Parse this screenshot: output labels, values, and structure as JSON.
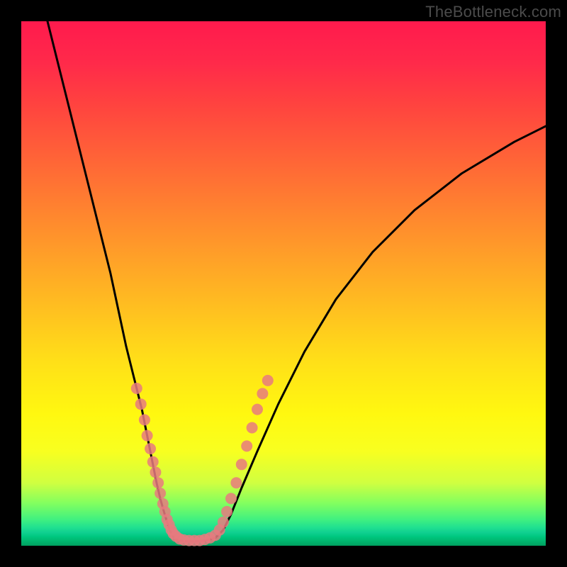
{
  "watermark": {
    "text": "TheBottleneck.com"
  },
  "chart_data": {
    "type": "line",
    "title": "",
    "xlabel": "",
    "ylabel": "",
    "xlim": [
      0,
      100
    ],
    "ylim": [
      0,
      100
    ],
    "grid": false,
    "background_gradient": {
      "top": "#ff1a4d",
      "mid_upper": "#ff8030",
      "mid": "#ffe018",
      "lower": "#80ff60",
      "bottom": "#00a060"
    },
    "series": [
      {
        "name": "left-branch",
        "color": "#000000",
        "x": [
          5,
          7,
          9,
          11,
          13,
          15,
          17,
          18.5,
          20,
          21.5,
          23,
          24,
          25,
          25.8,
          26.5,
          27.2,
          27.8,
          28.3,
          28.8,
          29.2
        ],
        "y": [
          100,
          92,
          84,
          76,
          68,
          60,
          52,
          45,
          38,
          32,
          26,
          21,
          16,
          12,
          9,
          6.5,
          4.5,
          3,
          2,
          1.3
        ]
      },
      {
        "name": "valley-floor",
        "color": "#000000",
        "x": [
          29.2,
          30,
          31,
          32,
          33,
          34,
          35,
          36,
          37
        ],
        "y": [
          1.3,
          1.0,
          0.9,
          0.85,
          0.85,
          0.9,
          1.0,
          1.2,
          1.5
        ]
      },
      {
        "name": "right-branch",
        "color": "#000000",
        "x": [
          37,
          38.5,
          40,
          42,
          45,
          49,
          54,
          60,
          67,
          75,
          84,
          94,
          100
        ],
        "y": [
          1.5,
          3,
          6,
          11,
          18,
          27,
          37,
          47,
          56,
          64,
          71,
          77,
          80
        ]
      }
    ],
    "scatter": {
      "name": "dots",
      "color": "#e77a7f",
      "radius_px": 8,
      "points": [
        {
          "x": 22.0,
          "y": 30.0
        },
        {
          "x": 22.8,
          "y": 27.0
        },
        {
          "x": 23.5,
          "y": 24.0
        },
        {
          "x": 24.0,
          "y": 21.0
        },
        {
          "x": 24.6,
          "y": 18.5
        },
        {
          "x": 25.1,
          "y": 16.0
        },
        {
          "x": 25.6,
          "y": 14.0
        },
        {
          "x": 26.1,
          "y": 12.0
        },
        {
          "x": 26.5,
          "y": 10.0
        },
        {
          "x": 27.0,
          "y": 8.0
        },
        {
          "x": 27.4,
          "y": 6.5
        },
        {
          "x": 27.8,
          "y": 5.0
        },
        {
          "x": 28.2,
          "y": 4.0
        },
        {
          "x": 28.6,
          "y": 3.0
        },
        {
          "x": 29.0,
          "y": 2.3
        },
        {
          "x": 29.5,
          "y": 1.8
        },
        {
          "x": 30.2,
          "y": 1.3
        },
        {
          "x": 31.0,
          "y": 1.1
        },
        {
          "x": 32.0,
          "y": 1.0
        },
        {
          "x": 33.0,
          "y": 1.0
        },
        {
          "x": 34.0,
          "y": 1.0
        },
        {
          "x": 35.0,
          "y": 1.2
        },
        {
          "x": 36.0,
          "y": 1.5
        },
        {
          "x": 37.0,
          "y": 2.0
        },
        {
          "x": 37.8,
          "y": 3.0
        },
        {
          "x": 38.5,
          "y": 4.5
        },
        {
          "x": 39.2,
          "y": 6.5
        },
        {
          "x": 40.0,
          "y": 9.0
        },
        {
          "x": 41.0,
          "y": 12.0
        },
        {
          "x": 42.0,
          "y": 15.5
        },
        {
          "x": 43.0,
          "y": 19.0
        },
        {
          "x": 44.0,
          "y": 22.5
        },
        {
          "x": 45.0,
          "y": 26.0
        },
        {
          "x": 46.0,
          "y": 29.0
        },
        {
          "x": 47.0,
          "y": 31.5
        }
      ]
    }
  }
}
